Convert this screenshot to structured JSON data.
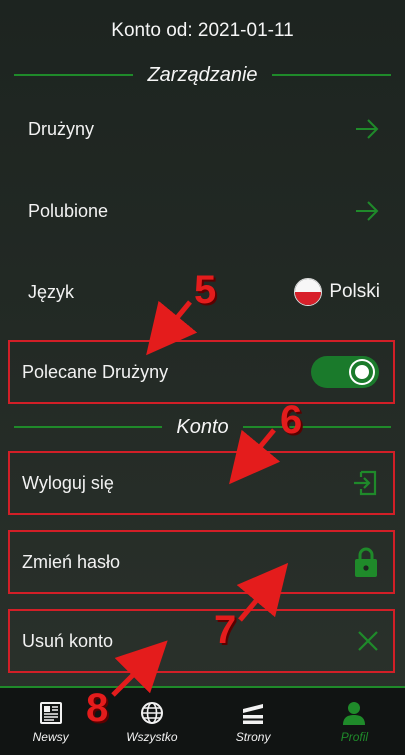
{
  "header": {
    "account_since": "Konto od: 2021-01-11"
  },
  "sections": {
    "management": {
      "title": "Zarządzanie"
    },
    "account": {
      "title": "Konto"
    }
  },
  "rows": {
    "teams": {
      "label": "Drużyny",
      "icon": "arrow-right-icon"
    },
    "liked": {
      "label": "Polubione",
      "icon": "arrow-right-icon"
    },
    "language": {
      "label": "Język",
      "value": "Polski",
      "icon": "poland-flag-icon"
    },
    "recommended": {
      "label": "Polecane Drużyny",
      "toggle_state": "on"
    },
    "logout": {
      "label": "Wyloguj się",
      "icon": "logout-icon"
    },
    "change_password": {
      "label": "Zmień hasło",
      "icon": "lock-icon"
    },
    "delete_account": {
      "label": "Usuń konto",
      "icon": "close-icon"
    }
  },
  "bottom_nav": {
    "items": [
      {
        "label": "Newsy",
        "icon": "newspaper-icon",
        "active": false
      },
      {
        "label": "Wszystko",
        "icon": "globe-icon",
        "active": false
      },
      {
        "label": "Strony",
        "icon": "pages-icon",
        "active": false
      },
      {
        "label": "Profil",
        "icon": "user-icon",
        "active": true
      }
    ]
  },
  "annotations": {
    "n5": "5",
    "n6": "6",
    "n7": "7",
    "n8": "8"
  },
  "colors": {
    "accent": "#1f8a2a",
    "highlight_box": "#d21f27",
    "annotation": "#e41c1c"
  }
}
